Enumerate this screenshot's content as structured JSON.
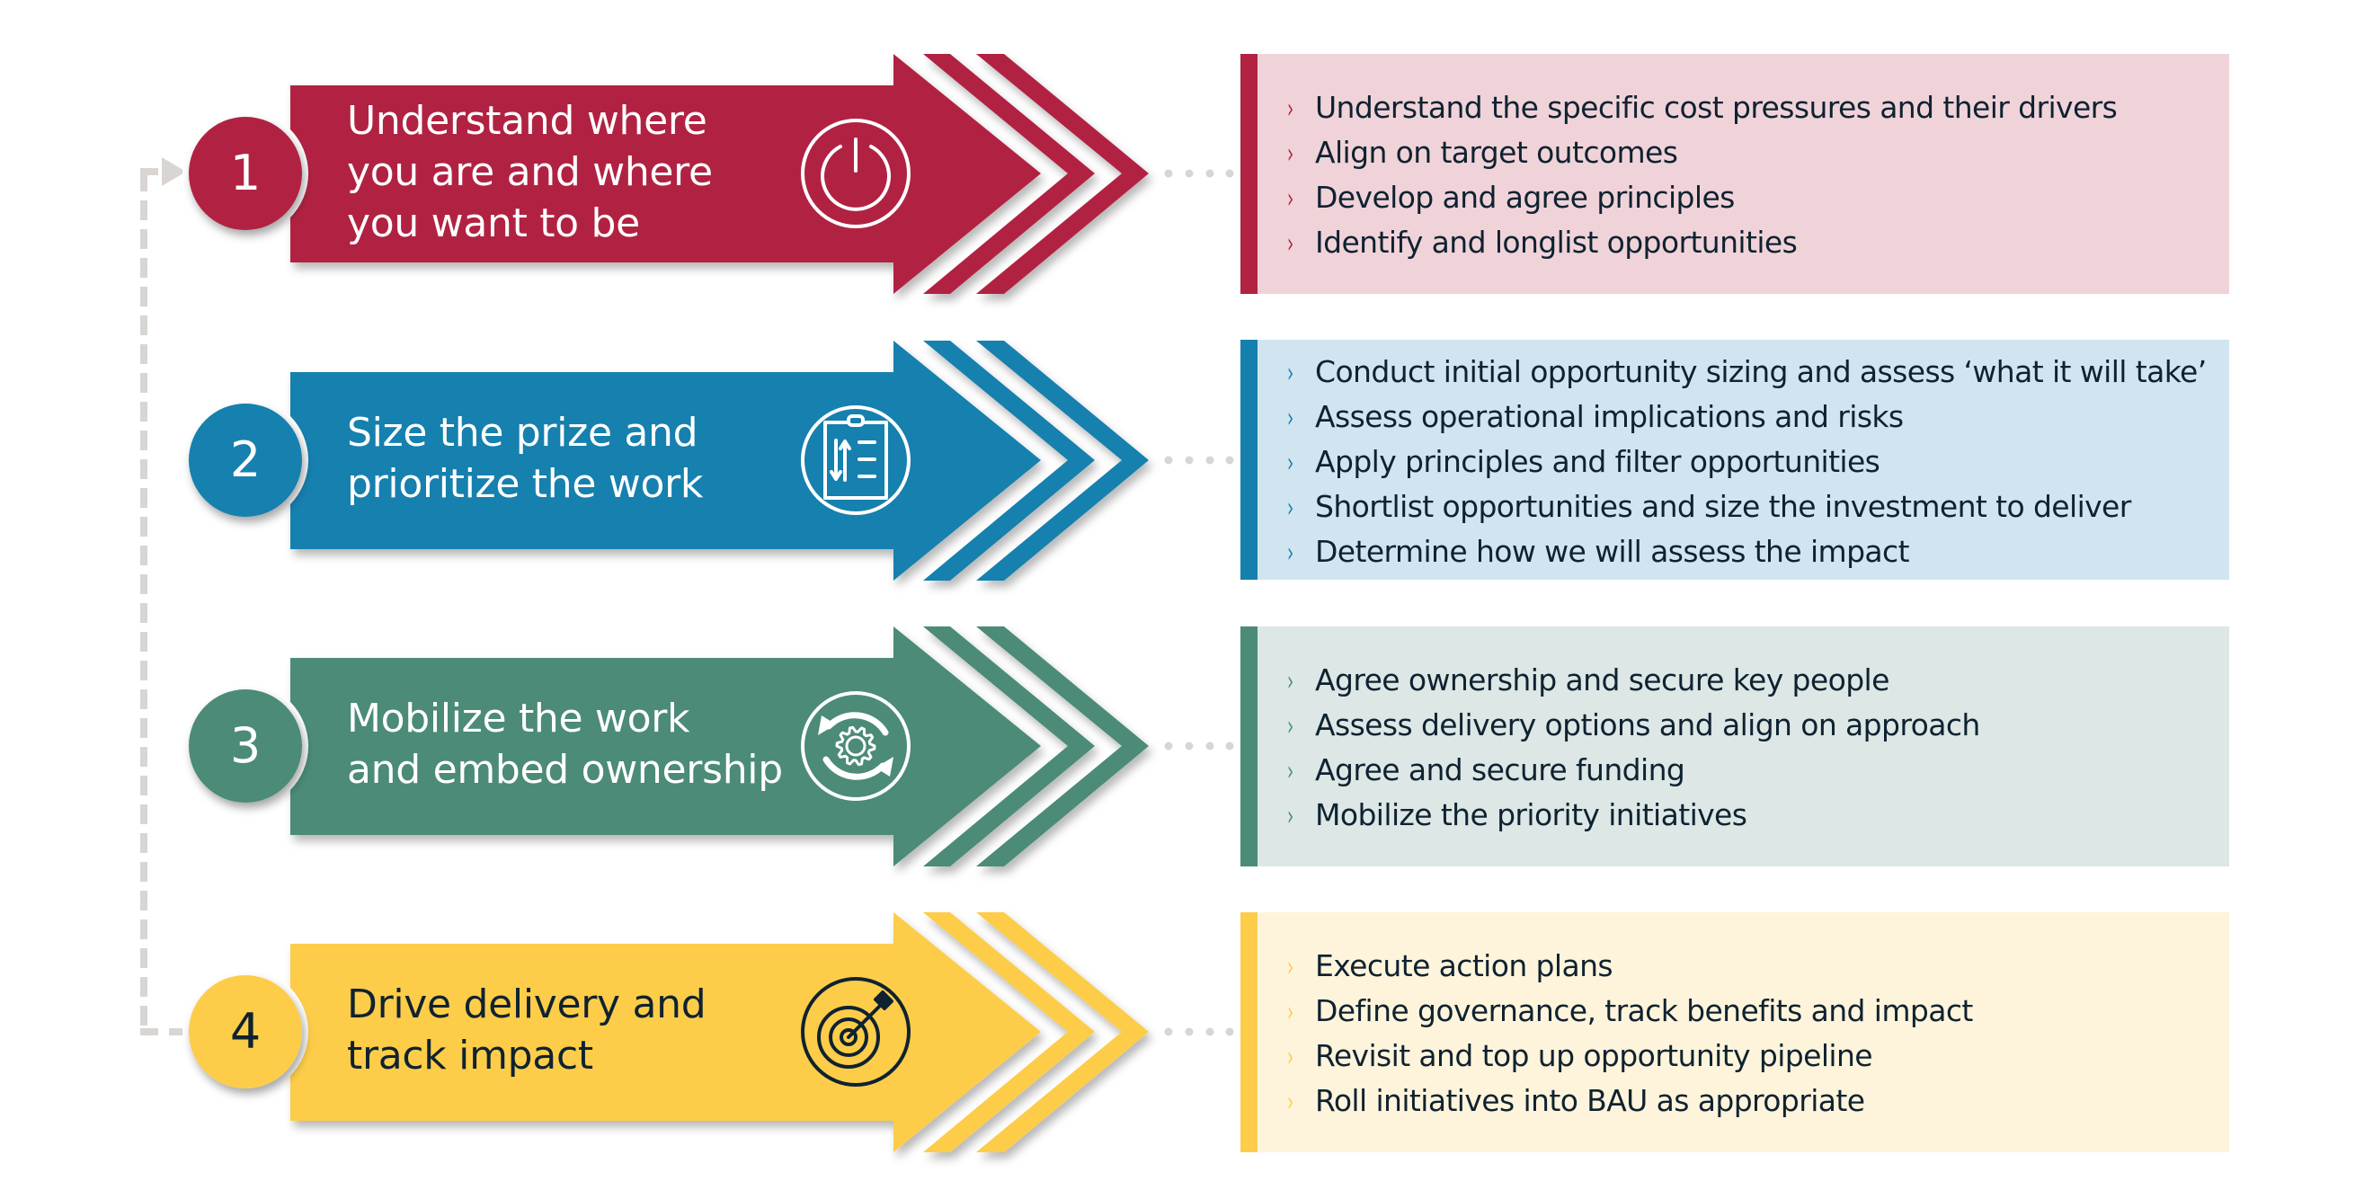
{
  "colors": {
    "connector": "#d9d5d2",
    "text_dark": "#0f2230",
    "text_light": "#ffffff"
  },
  "steps": [
    {
      "number": "1",
      "title_lines": [
        "Understand where",
        "you are and where",
        "you want to be"
      ],
      "icon": "power-icon",
      "color": "#b12243",
      "box_bg": "#f0d3d9",
      "text_color": "#ffffff",
      "bullets": [
        "Understand the specific cost pressures and their drivers",
        "Align on target outcomes",
        "Develop and agree principles",
        "Identify and longlist opportunities"
      ]
    },
    {
      "number": "2",
      "title_lines": [
        "Size the prize and",
        "prioritize the work"
      ],
      "icon": "clipboard-sort-icon",
      "color": "#1580ae",
      "box_bg": "#d0e5f0",
      "text_color": "#ffffff",
      "bullets": [
        "Conduct initial opportunity sizing and assess ‘what it will take’",
        "Assess operational implications and risks",
        "Apply principles and filter opportunities",
        "Shortlist opportunities and size the investment to deliver",
        "Determine how we will assess the impact"
      ]
    },
    {
      "number": "3",
      "title_lines": [
        "Mobilize the work",
        "and embed ownership"
      ],
      "icon": "gear-cycle-icon",
      "color": "#4b8b78",
      "box_bg": "#dce7e6",
      "text_color": "#ffffff",
      "bullets": [
        "Agree ownership and secure key people",
        "Assess delivery options and align on approach",
        "Agree and secure funding",
        "Mobilize the priority initiatives"
      ]
    },
    {
      "number": "4",
      "title_lines": [
        "Drive delivery and",
        "track impact"
      ],
      "icon": "target-arrow-icon",
      "color": "#fdcd4a",
      "box_bg": "#fef4db",
      "text_color": "#0f2230",
      "bullets": [
        "Execute action plans",
        "Define governance, track benefits and impact",
        "Revisit and top up opportunity pipeline",
        "Roll initiatives into BAU as appropriate"
      ]
    }
  ],
  "bullet_glyph": "›"
}
